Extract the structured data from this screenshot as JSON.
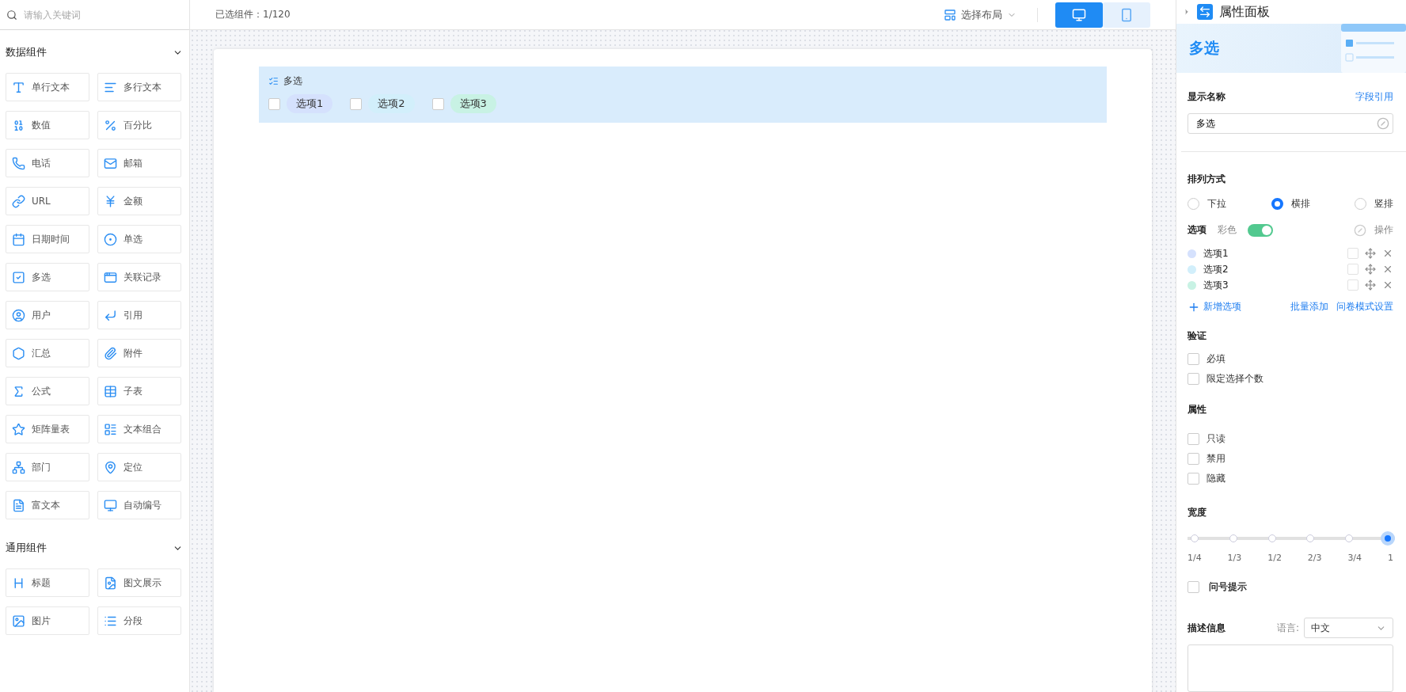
{
  "sidebar": {
    "search": {
      "placeholder": "请输入关键词"
    },
    "groups": [
      {
        "title": "数据组件",
        "expanded": true,
        "items": [
          "单行文本",
          "多行文本",
          "数值",
          "百分比",
          "电话",
          "邮箱",
          "URL",
          "金额",
          "日期时间",
          "单选",
          "多选",
          "关联记录",
          "用户",
          "引用",
          "汇总",
          "附件",
          "公式",
          "子表",
          "矩阵量表",
          "文本组合",
          "部门",
          "定位",
          "富文本",
          "自动编号"
        ]
      },
      {
        "title": "通用组件",
        "expanded": true,
        "items": [
          "标题",
          "图文展示",
          "图片",
          "分段"
        ]
      }
    ]
  },
  "toolbar": {
    "selected_label": "已选组件：",
    "selected_count": "1/120",
    "layout_button": "选择布局",
    "devices": [
      {
        "kind": "desktop",
        "selected": true
      },
      {
        "kind": "mobile",
        "selected": false
      }
    ]
  },
  "canvas": {
    "field": {
      "title": "多选",
      "options": [
        {
          "label": "选项1",
          "checked": false,
          "color": "#d5e1fd"
        },
        {
          "label": "选项2",
          "checked": false,
          "color": "#d2effb"
        },
        {
          "label": "选项3",
          "checked": false,
          "color": "#c8f2e4"
        }
      ]
    }
  },
  "panel": {
    "title": "属性面板",
    "banner_title": "多选",
    "display_name": {
      "label": "显示名称",
      "link": "字段引用",
      "value": "多选"
    },
    "arrangement": {
      "label": "排列方式",
      "options": [
        {
          "label": "下拉",
          "selected": false
        },
        {
          "label": "横排",
          "selected": true
        },
        {
          "label": "竖排",
          "selected": false
        }
      ]
    },
    "options": {
      "label": "选项",
      "colorful_label": "彩色",
      "colorful": true,
      "action_label": "操作",
      "items": [
        {
          "label": "选项1",
          "color": "#d5e1fd",
          "default": false
        },
        {
          "label": "选项2",
          "color": "#d2effb",
          "default": false
        },
        {
          "label": "选项3",
          "color": "#c8f2e4",
          "default": false
        }
      ],
      "add": "新增选项",
      "batch_add": "批量添加",
      "survey_settings": "问卷模式设置"
    },
    "validation": {
      "label": "验证",
      "items": [
        {
          "label": "必填",
          "checked": false
        },
        {
          "label": "限定选择个数",
          "checked": false
        }
      ]
    },
    "attributes": {
      "label": "属性",
      "items": [
        {
          "label": "只读",
          "checked": false
        },
        {
          "label": "禁用",
          "checked": false
        },
        {
          "label": "隐藏",
          "checked": false
        }
      ]
    },
    "width": {
      "label": "宽度",
      "level": 1,
      "stops": [
        "1/4",
        "1/3",
        "1/2",
        "2/3",
        "3/4",
        "1"
      ]
    },
    "question_hint": {
      "label": "问号提示",
      "checked": false
    },
    "description": {
      "label": "描述信息",
      "language_label": "语言:",
      "language": "中文"
    }
  }
}
